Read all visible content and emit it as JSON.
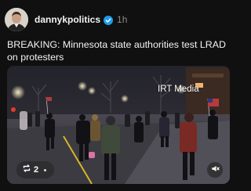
{
  "post": {
    "author": {
      "username": "dannykpolitics",
      "avatar_icon": "profile-photo",
      "verified_icon": "verified-badge-icon",
      "verified_color": "#1d9bf0"
    },
    "timestamp": "1h",
    "text": "BREAKING: Minnesota state authorities test LRAD on protesters",
    "media": {
      "watermark": "IRT Media",
      "repost_count": "2",
      "repost_icon": "repost-icon",
      "mute_icon": "speaker-muted-icon"
    }
  },
  "colors": {
    "background": "#101010",
    "text_primary": "#f3f3f3",
    "text_secondary": "#8a8a8a"
  }
}
